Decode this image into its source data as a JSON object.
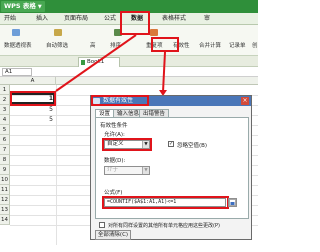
{
  "app": {
    "title": "WPS 表格"
  },
  "menu": {
    "items": [
      {
        "label": "开始"
      },
      {
        "label": "插入"
      },
      {
        "label": "页面布局"
      },
      {
        "label": "公式"
      },
      {
        "label": "数据"
      },
      {
        "label": "表格样式"
      },
      {
        "label": "审"
      }
    ]
  },
  "ribbon": {
    "items": [
      {
        "label": "数据透视表"
      },
      {
        "label": "自动筛选"
      },
      {
        "label": "高"
      },
      {
        "label": "排序"
      },
      {
        "label": "重复项"
      },
      {
        "label": "有效性"
      },
      {
        "label": "合并计算"
      },
      {
        "label": "记录单"
      },
      {
        "label": "创"
      }
    ]
  },
  "doc": {
    "tab_label": "Book1"
  },
  "formulabar": {
    "namebox": "A1"
  },
  "grid": {
    "column_a": "A",
    "rows": [
      {
        "num": "1",
        "value": "1"
      },
      {
        "num": "2",
        "value": ""
      },
      {
        "num": "3",
        "value": "5"
      },
      {
        "num": "4",
        "value": "5"
      },
      {
        "num": "5",
        "value": ""
      },
      {
        "num": "6",
        "value": ""
      },
      {
        "num": "7",
        "value": ""
      },
      {
        "num": "8",
        "value": ""
      },
      {
        "num": "9",
        "value": ""
      },
      {
        "num": "10",
        "value": ""
      },
      {
        "num": "11",
        "value": ""
      },
      {
        "num": "12",
        "value": ""
      },
      {
        "num": "13",
        "value": ""
      },
      {
        "num": "14",
        "value": ""
      }
    ]
  },
  "dialog": {
    "title": "数据有效性",
    "tabs": [
      {
        "label": "设置"
      },
      {
        "label": "输入信息"
      },
      {
        "label": "出错警告"
      }
    ],
    "section_label": "有效性条件",
    "allow_label": "允许(A):",
    "allow_value": "自定义",
    "ignore_blank_label": "忽略空值(B)",
    "data_label": "数据(D):",
    "data_value": "介于",
    "formula_label": "公式(F)",
    "formula_value": "=COUNTIF($A$1:A1,A1)<=1",
    "apply_all_label": "对所有同样设置的其他所有单元格应用这些更改(P)",
    "clear_all_label": "全部清除(C)"
  },
  "colors": {
    "titlebar": "#2f8f3a",
    "dialog_title": "#4a76b8",
    "highlight": "#e0141b"
  }
}
